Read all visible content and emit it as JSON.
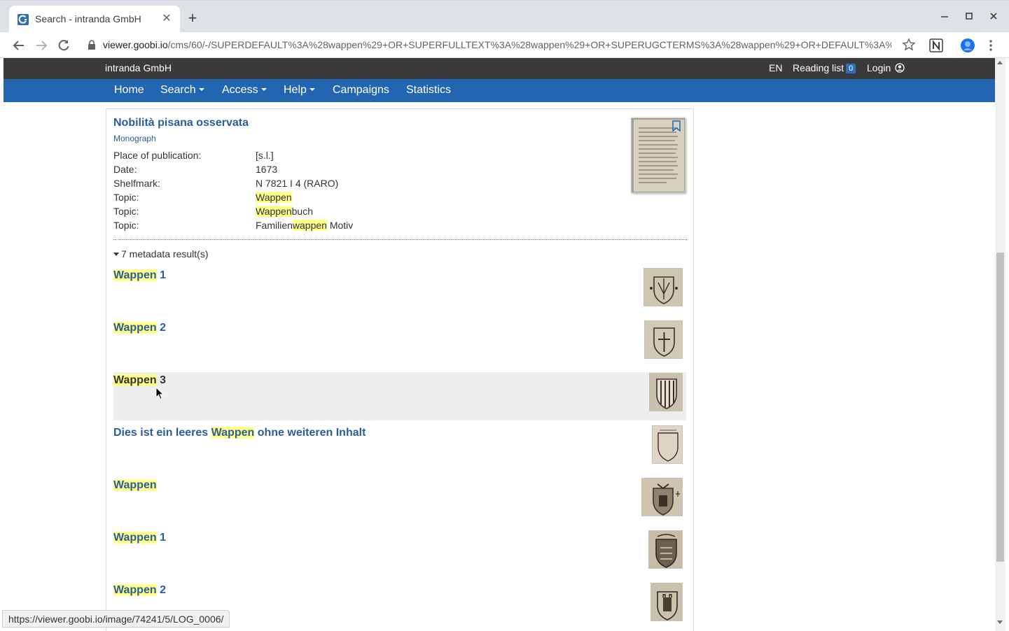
{
  "browser": {
    "tab_title": "Search - intranda GmbH",
    "url_host": "viewer.goobi.io",
    "url_path": "/cms/60/-/SUPERDEFAULT%3A%28wappen%29+OR+SUPERFULLTEXT%3A%28wappen%29+OR+SUPERUGCTERMS%3A%28wappen%29+OR+DEFAULT%3A%28wapp...",
    "status_url": "https://viewer.goobi.io/image/74241/5/LOG_0006/"
  },
  "topbar": {
    "brand": "intranda GmbH",
    "lang": "EN",
    "reading_list": "Reading list",
    "reading_count": "0",
    "login": "Login"
  },
  "nav": {
    "home": "Home",
    "search": "Search",
    "access": "Access",
    "help": "Help",
    "campaigns": "Campaigns",
    "statistics": "Statistics"
  },
  "result": {
    "title": "Nobilità pisana osservata",
    "type": "Monograph",
    "metadata": [
      {
        "key": "Place of publication:",
        "pre": "[s.l.]",
        "hl": "",
        "post": ""
      },
      {
        "key": "Date:",
        "pre": "1673",
        "hl": "",
        "post": ""
      },
      {
        "key": "Shelfmark:",
        "pre": "N 7821 I 4 (RARO)",
        "hl": "",
        "post": ""
      },
      {
        "key": "Topic:",
        "pre": "",
        "hl": "Wappen",
        "post": ""
      },
      {
        "key": "Topic:",
        "pre": "",
        "hl": "Wappen",
        "post": "buch"
      },
      {
        "key": "Topic:",
        "pre": "Familien",
        "hl": "wappen",
        "post": " Motiv"
      }
    ],
    "metadata_toggle": "7 metadata result(s)",
    "sub_results": [
      {
        "pre": "",
        "hl": "Wappen",
        "post": " 1"
      },
      {
        "pre": "",
        "hl": "Wappen",
        "post": " 2"
      },
      {
        "pre": "",
        "hl": "Wappen",
        "post": " 3"
      },
      {
        "pre": "Dies ist ein leeres ",
        "hl": "Wappen",
        "post": " ohne weiteren Inhalt"
      },
      {
        "pre": "",
        "hl": "Wappen",
        "post": ""
      },
      {
        "pre": "",
        "hl": "Wappen",
        "post": " 1"
      },
      {
        "pre": "",
        "hl": "Wappen",
        "post": " 2"
      }
    ]
  },
  "colors": {
    "navbar": "#2266b2",
    "topbar": "#3a3a3a",
    "link": "#2a5d98",
    "highlight": "#ffff8c"
  }
}
